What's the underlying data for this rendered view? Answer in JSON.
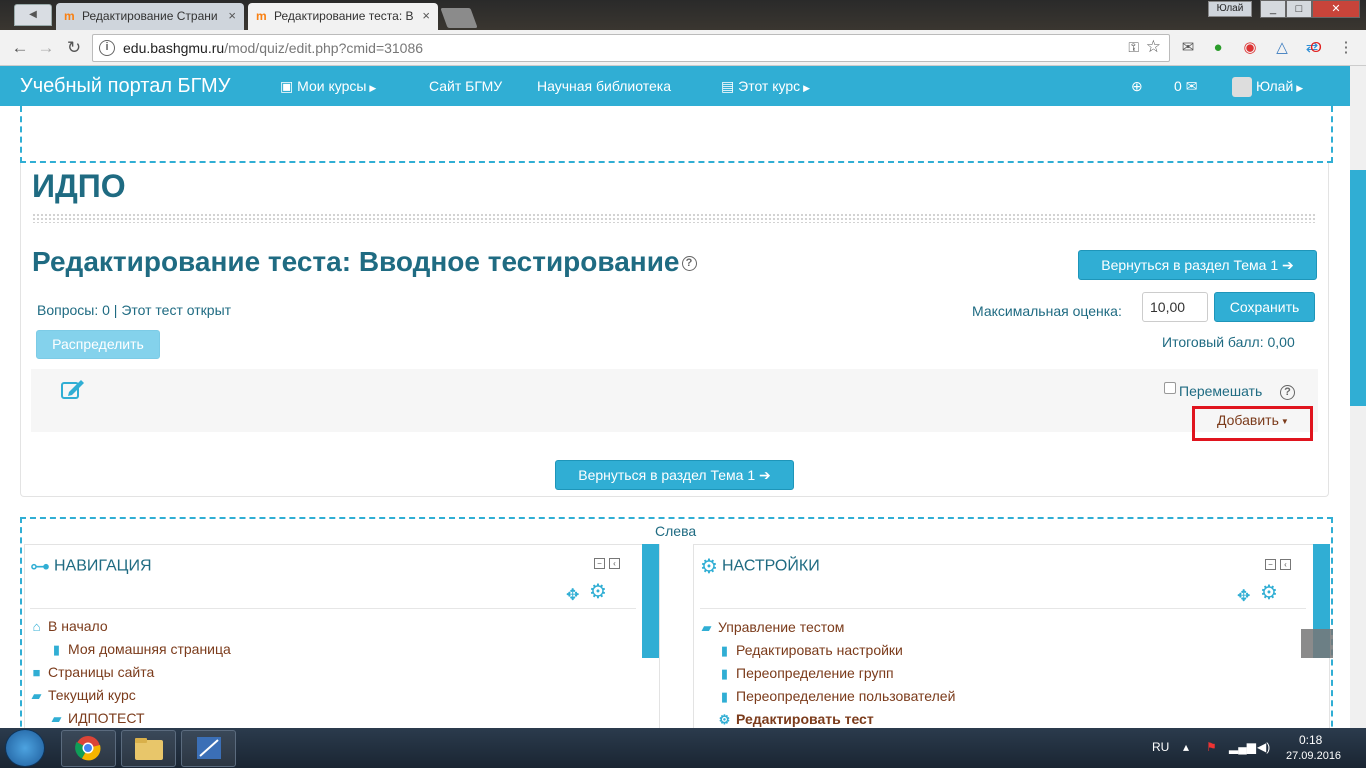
{
  "browser": {
    "tabs": [
      {
        "title": "Редактирование Страни"
      },
      {
        "title": "Редактирование теста: В"
      }
    ],
    "window_user": "Юлай",
    "url_host": "edu.bashgmu.ru",
    "url_path": "/mod/quiz/edit.php?cmid=31086"
  },
  "navbar": {
    "brand": "Учебный портал БГМУ",
    "my_courses": "Мои курсы",
    "site": "Сайт БГМУ",
    "library": "Научная библиотека",
    "this_course": "Этот курс",
    "messages_count": "0",
    "user": "Юлай"
  },
  "main": {
    "course_title": "ИДПО",
    "page_title": "Редактирование теста: Вводное тестирование",
    "return_button": "Вернуться в раздел Тема 1",
    "questions_info": "Вопросы: 0 | Этот тест открыт",
    "distribute_button": "Распределить",
    "max_grade_label": "Максимальная оценка:",
    "max_grade_value": "10,00",
    "save_button": "Сохранить",
    "total_grade": "Итоговый балл: 0,00",
    "shuffle_label": "Перемешать",
    "add_label": "Добавить"
  },
  "region": {
    "label": "Слева"
  },
  "navigation_block": {
    "title": "НАВИГАЦИЯ",
    "items": [
      {
        "label": "В начало",
        "icon": "home-icon"
      },
      {
        "label": "Моя домашняя страница",
        "icon": "page-icon"
      },
      {
        "label": "Страницы сайта",
        "icon": "folder-icon"
      },
      {
        "label": "Текущий курс",
        "icon": "folder-open-icon"
      },
      {
        "label": "ИДПОТЕСТ",
        "icon": "folder-open-icon"
      }
    ]
  },
  "settings_block": {
    "title": "НАСТРОЙКИ",
    "items": [
      {
        "label": "Управление тестом",
        "icon": "folder-open-icon"
      },
      {
        "label": "Редактировать настройки",
        "icon": "page-icon"
      },
      {
        "label": "Переопределение групп",
        "icon": "page-icon"
      },
      {
        "label": "Переопределение пользователей",
        "icon": "page-icon"
      },
      {
        "label": "Редактировать тест",
        "icon": "gear-icon"
      }
    ]
  },
  "taskbar": {
    "lang": "RU",
    "time": "0:18",
    "date": "27.09.2016"
  },
  "colors": {
    "accent": "#30aed4",
    "heading": "#1f6b82",
    "link": "#7b3b1b",
    "highlight": "#e0141e"
  }
}
